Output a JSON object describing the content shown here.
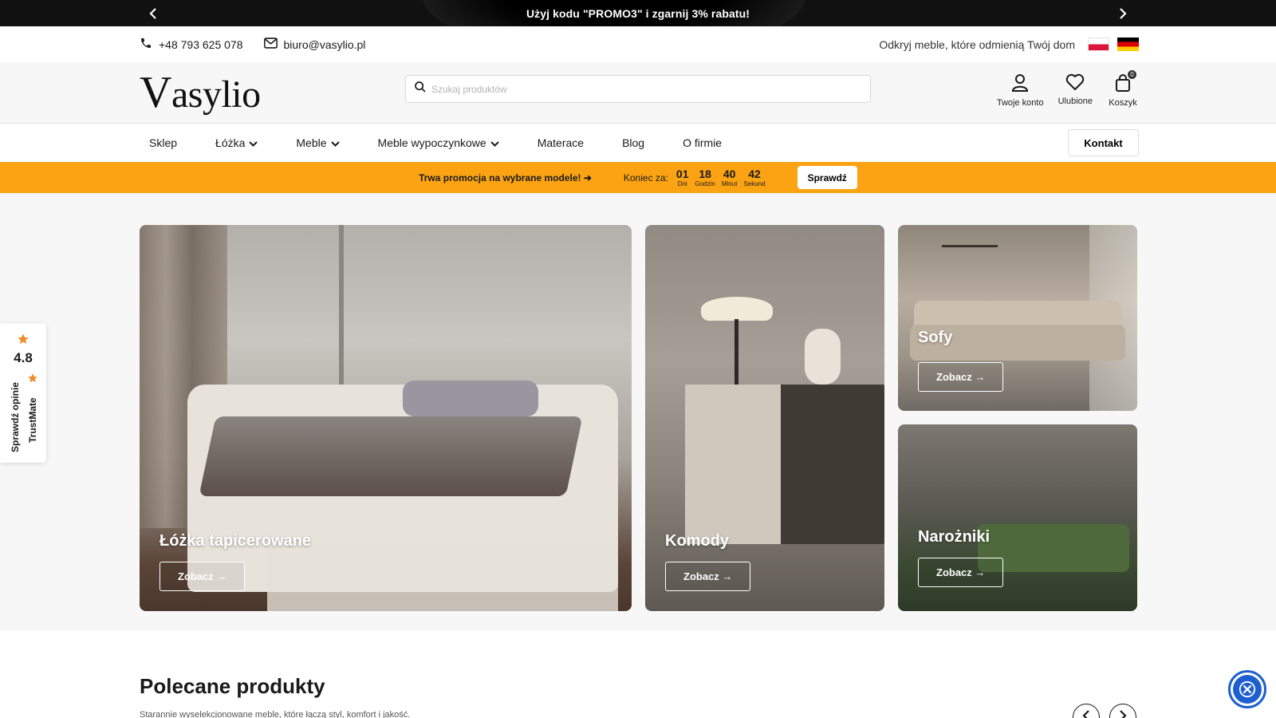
{
  "topbar": {
    "promo_text": "Użyj kodu \"PROMO3\" i zgarnij 3% rabatu!",
    "prev_icon": "chevron-left-icon",
    "next_icon": "chevron-right-icon"
  },
  "contact": {
    "phone": "+48 793 625 078",
    "email": "biuro@vasylio.pl",
    "tagline": "Odkryj meble, które odmienią Twój dom"
  },
  "header": {
    "logo": "asylio",
    "logo_initial": "V",
    "search_placeholder": "Szukaj produktów",
    "icons": {
      "account": "Twoje konto",
      "favorites": "Ulubione",
      "cart": "Koszyk",
      "cart_count": "0"
    }
  },
  "nav": {
    "items": [
      {
        "label": "Sklep"
      },
      {
        "label": "Łóżka"
      },
      {
        "label": "Meble"
      },
      {
        "label": "Meble wypoczynkowe"
      },
      {
        "label": "Materace"
      },
      {
        "label": "Blog"
      },
      {
        "label": "O firmie"
      }
    ],
    "contact_button": "Kontakt"
  },
  "promo": {
    "link_text": "Trwa promocja na wybrane modele! ➜",
    "countdown_label": "Koniec za:",
    "days": "01",
    "days_label": "Dni",
    "hours": "18",
    "hours_label": "Godzin",
    "minutes": "40",
    "minutes_label": "Minut",
    "seconds": "42",
    "seconds_label": "Sekund",
    "button": "Sprawdź"
  },
  "hero": {
    "cards": [
      {
        "title": "Łóżka tapicerowane",
        "button": "Zobacz →"
      },
      {
        "title": "Komody",
        "button": "Zobacz →"
      },
      {
        "title": "Sofy",
        "button": "Zobacz →"
      },
      {
        "title": "Narożniki",
        "button": "Zobacz →"
      }
    ]
  },
  "trustmate": {
    "rating": "4.8",
    "check_text": "Sprawdź opinie",
    "brand": "TrustMate"
  },
  "featured": {
    "title": "Polecane produkty",
    "subtitle": "Starannie wyselekcjonowane meble, które łączą styl, komfort i jakość."
  },
  "colors": {
    "promo_orange": "#fca313",
    "topbar_black": "#111111",
    "accessibility_blue": "#1e5fd0",
    "trustmate_star": "#f08b2a"
  }
}
